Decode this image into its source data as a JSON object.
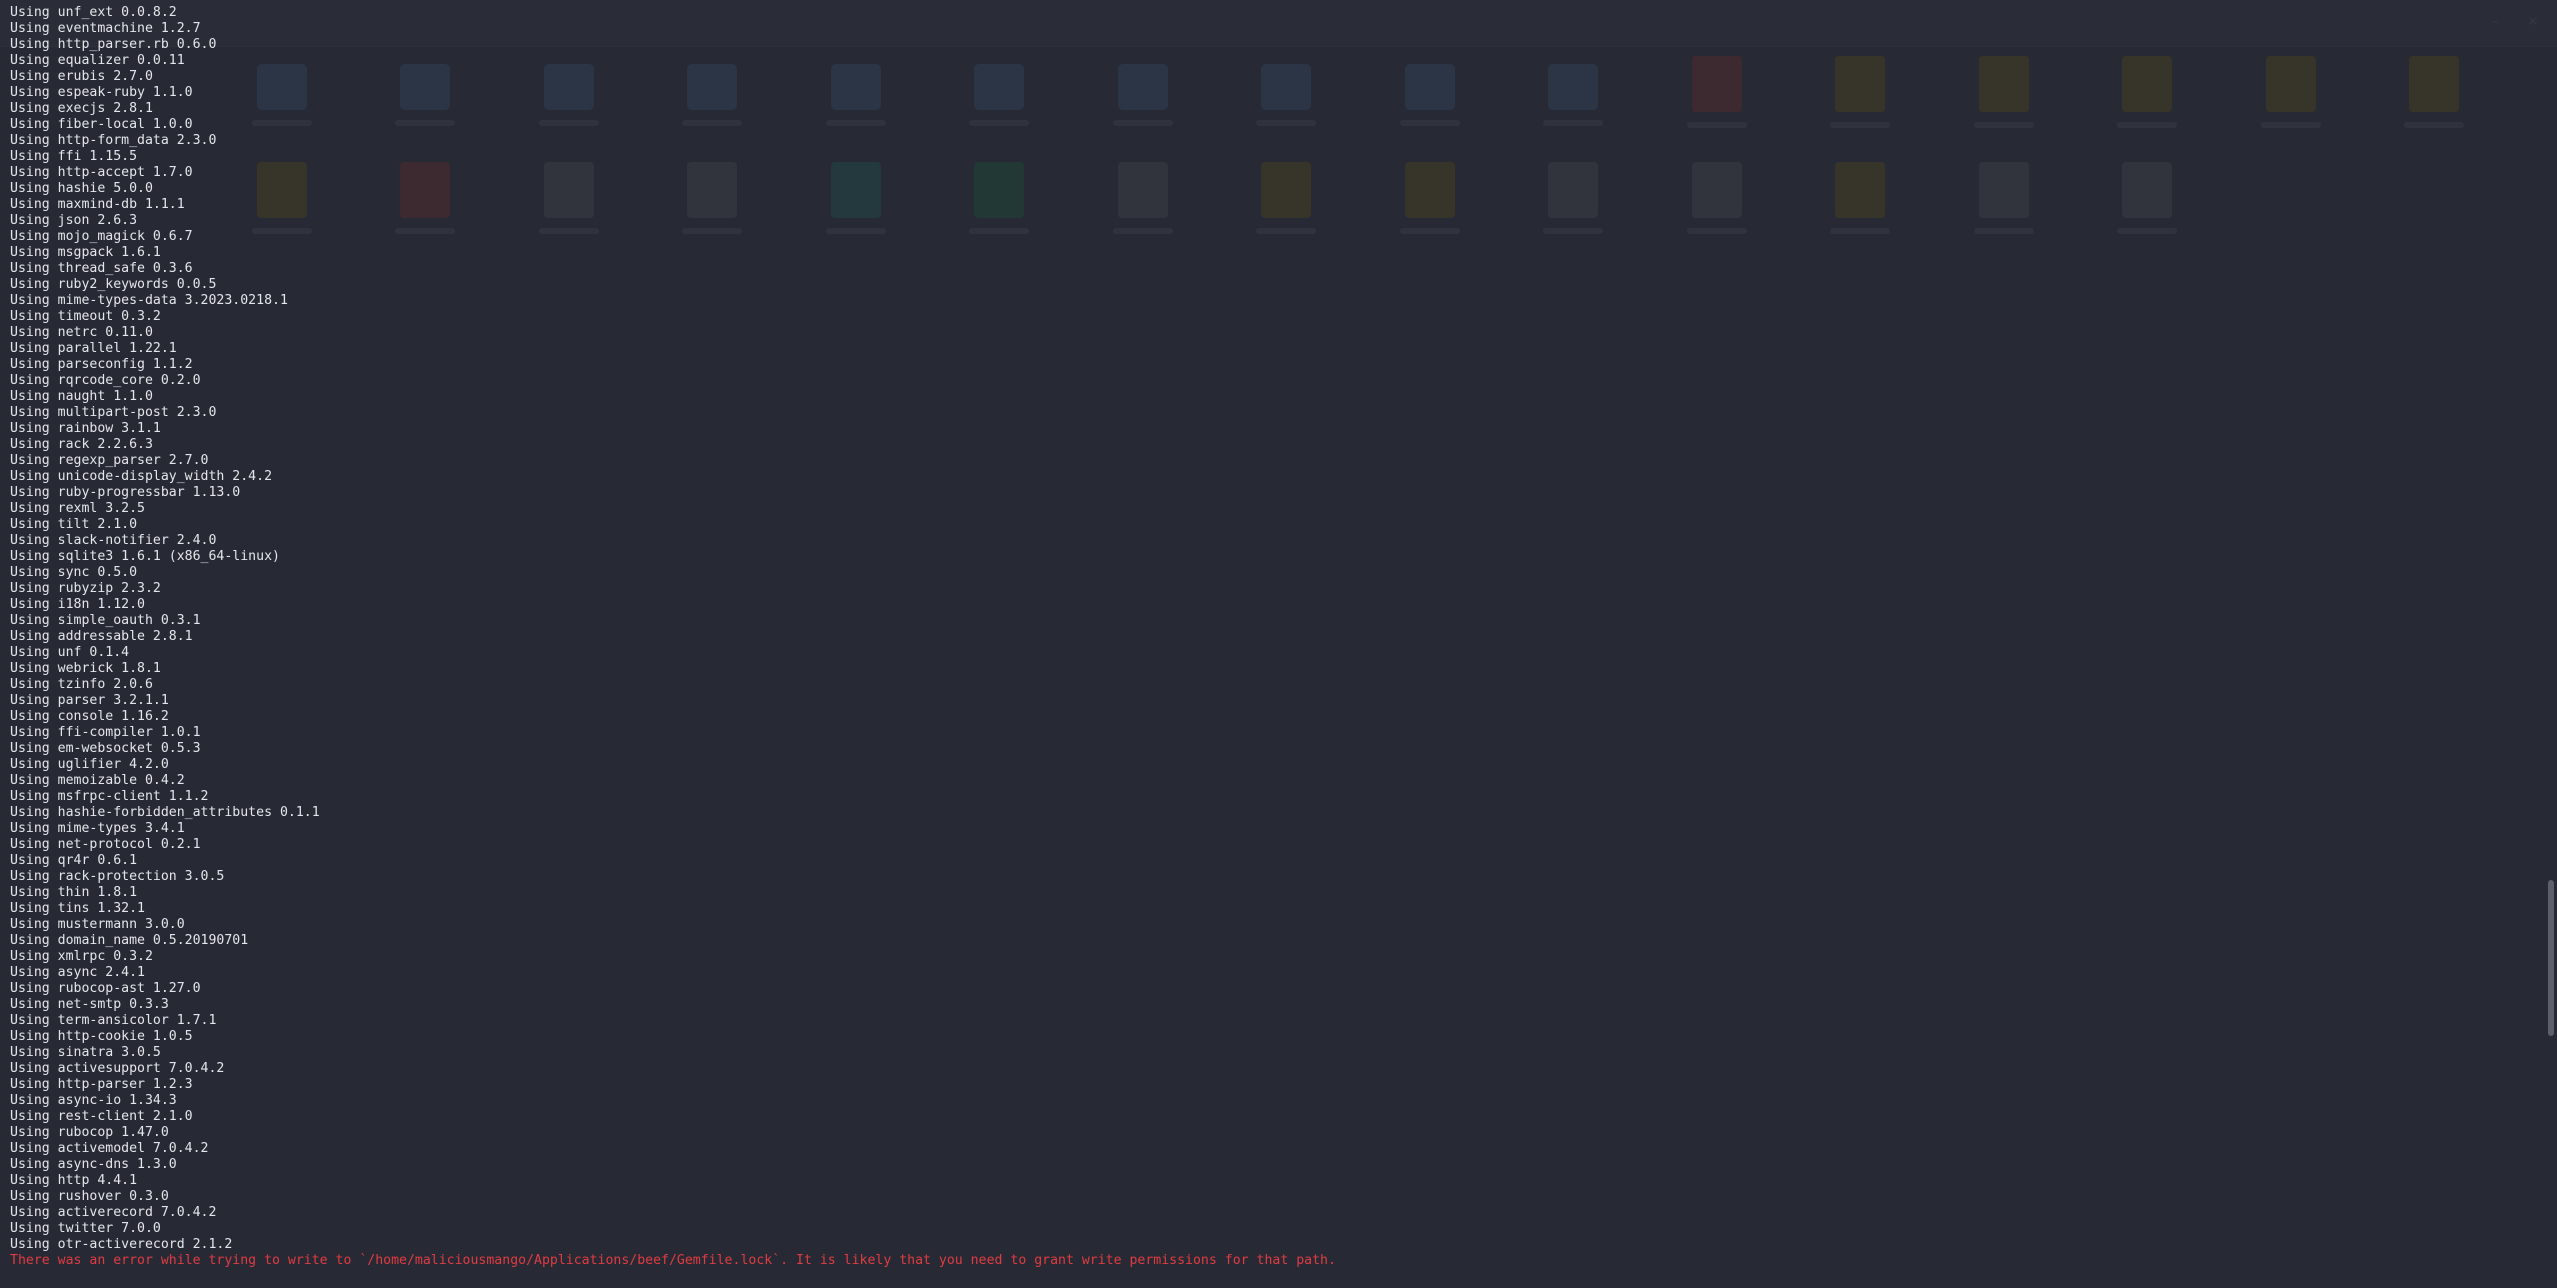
{
  "terminal": {
    "lines": [
      "Using unf_ext 0.0.8.2",
      "Using eventmachine 1.2.7",
      "Using http_parser.rb 0.6.0",
      "Using equalizer 0.0.11",
      "Using erubis 2.7.0",
      "Using espeak-ruby 1.1.0",
      "Using execjs 2.8.1",
      "Using fiber-local 1.0.0",
      "Using http-form_data 2.3.0",
      "Using ffi 1.15.5",
      "Using http-accept 1.7.0",
      "Using hashie 5.0.0",
      "Using maxmind-db 1.1.1",
      "Using json 2.6.3",
      "Using mojo_magick 0.6.7",
      "Using msgpack 1.6.1",
      "Using thread_safe 0.3.6",
      "Using ruby2_keywords 0.0.5",
      "Using mime-types-data 3.2023.0218.1",
      "Using timeout 0.3.2",
      "Using netrc 0.11.0",
      "Using parallel 1.22.1",
      "Using parseconfig 1.1.2",
      "Using rqrcode_core 0.2.0",
      "Using naught 1.1.0",
      "Using multipart-post 2.3.0",
      "Using rainbow 3.1.1",
      "Using rack 2.2.6.3",
      "Using regexp_parser 2.7.0",
      "Using unicode-display_width 2.4.2",
      "Using ruby-progressbar 1.13.0",
      "Using rexml 3.2.5",
      "Using tilt 2.1.0",
      "Using slack-notifier 2.4.0",
      "Using sqlite3 1.6.1 (x86_64-linux)",
      "Using sync 0.5.0",
      "Using rubyzip 2.3.2",
      "Using i18n 1.12.0",
      "Using simple_oauth 0.3.1",
      "Using addressable 2.8.1",
      "Using unf 0.1.4",
      "Using webrick 1.8.1",
      "Using tzinfo 2.0.6",
      "Using parser 3.2.1.1",
      "Using console 1.16.2",
      "Using ffi-compiler 1.0.1",
      "Using em-websocket 0.5.3",
      "Using uglifier 4.2.0",
      "Using memoizable 0.4.2",
      "Using msfrpc-client 1.1.2",
      "Using hashie-forbidden_attributes 0.1.1",
      "Using mime-types 3.4.1",
      "Using net-protocol 0.2.1",
      "Using qr4r 0.6.1",
      "Using rack-protection 3.0.5",
      "Using thin 1.8.1",
      "Using tins 1.32.1",
      "Using mustermann 3.0.0",
      "Using domain_name 0.5.20190701",
      "Using xmlrpc 0.3.2",
      "Using async 2.4.1",
      "Using rubocop-ast 1.27.0",
      "Using net-smtp 0.3.3",
      "Using term-ansicolor 1.7.1",
      "Using http-cookie 1.0.5",
      "Using sinatra 3.0.5",
      "Using activesupport 7.0.4.2",
      "Using http-parser 1.2.3",
      "Using async-io 1.34.3",
      "Using rest-client 2.1.0",
      "Using rubocop 1.47.0",
      "Using activemodel 7.0.4.2",
      "Using async-dns 1.3.0",
      "Using http 4.4.1",
      "Using rushover 0.3.0",
      "Using activerecord 7.0.4.2",
      "Using twitter 7.0.0",
      "Using otr-activerecord 2.1.2"
    ],
    "error_line": "There was an error while trying to write to `/home/maliciousmango/Applications/beef/Gemfile.lock`. It is likely that you need to grant write permissions for that path."
  },
  "colors": {
    "background": "#272a34",
    "text": "#e4e6ec",
    "error": "#e03b42",
    "scrollbar_thumb": "#5d606a"
  },
  "background_desktop": {
    "window_buttons": [
      "minimize-icon",
      "close-icon"
    ],
    "icon_kinds": [
      "folder",
      "folder",
      "folder",
      "folder",
      "folder",
      "folder",
      "folder",
      "folder",
      "folder",
      "folder",
      "red",
      "warm",
      "warm",
      "warm",
      "warm",
      "warm",
      "warm",
      "red",
      "file",
      "file",
      "teal",
      "green",
      "file",
      "warm",
      "warm",
      "file",
      "file",
      "warm",
      "file",
      "file"
    ]
  }
}
